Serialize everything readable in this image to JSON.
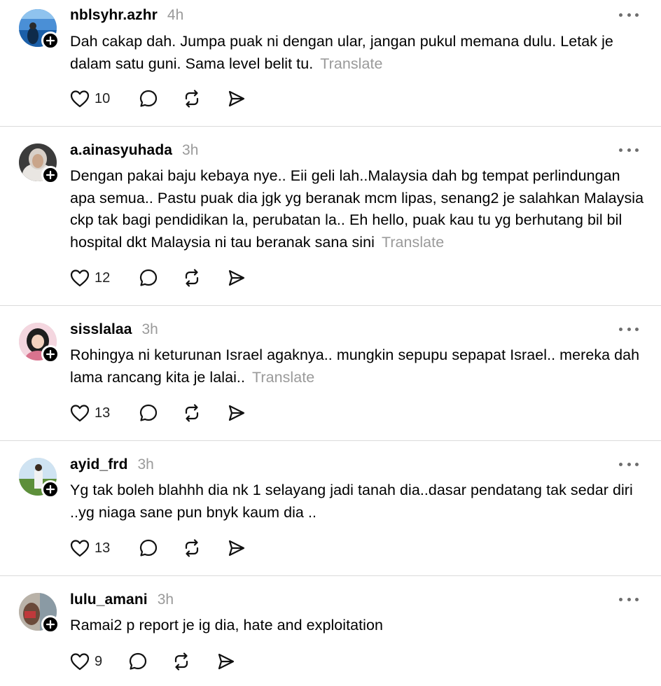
{
  "posts": [
    {
      "username": "nblsyhr.azhr",
      "time": "4h",
      "text": "Dah cakap dah. Jumpa puak ni dengan ular, jangan pukul memana dulu. Letak je dalam satu guni. Sama level belit tu.",
      "translate": "Translate",
      "likes": "10"
    },
    {
      "username": "a.ainasyuhada",
      "time": "3h",
      "text": "Dengan pakai baju kebaya nye.. Eii geli lah..Malaysia dah bg tempat perlindungan apa semua.. Pastu puak dia jgk yg beranak mcm lipas, senang2 je salahkan Malaysia ckp tak bagi pendidikan la, perubatan la.. Eh hello, puak kau tu yg berhutang bil bil hospital dkt Malaysia ni tau beranak sana sini",
      "translate": "Translate",
      "likes": "12"
    },
    {
      "username": "sisslalaa",
      "time": "3h",
      "text": "Rohingya ni keturunan Israel agaknya.. mungkin sepupu sepapat Israel.. mereka dah lama rancang kita je lalai..",
      "translate": "Translate",
      "likes": "13"
    },
    {
      "username": "ayid_frd",
      "time": "3h",
      "text": "Yg tak boleh blahhh dia nk 1 selayang jadi tanah dia..dasar pendatang tak sedar diri ..yg niaga sane pun bnyk kaum dia ..",
      "translate": "",
      "likes": "13"
    },
    {
      "username": "lulu_amani",
      "time": "3h",
      "text": "Ramai2 p report je ig dia, hate and exploitation",
      "translate": "",
      "likes": "9"
    }
  ],
  "icons": {
    "like": "heart-icon",
    "reply": "comment-bubble-icon",
    "repost": "repost-icon",
    "share": "send-icon",
    "more": "more-horizontal-icon",
    "follow": "plus-icon"
  }
}
